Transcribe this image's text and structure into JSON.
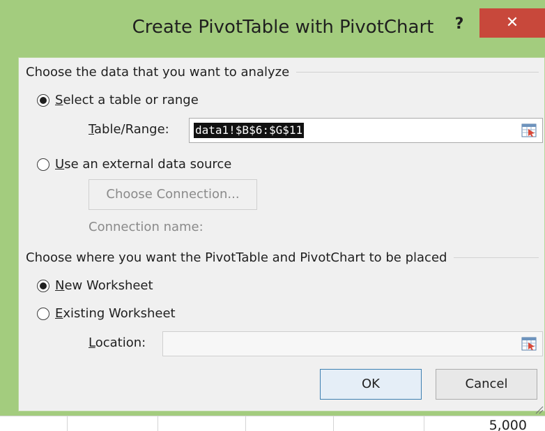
{
  "dialog": {
    "title": "Create PivotTable with PivotChart",
    "help_label": "?",
    "close_label": "✕",
    "title_bar_color": "#a3cc7e"
  },
  "data_source": {
    "heading": "Choose the data that you want to analyze",
    "option_range": {
      "prefix": "S",
      "rest": "elect a table or range",
      "checked": true
    },
    "table_range_label_prefix": "T",
    "table_range_label_rest": "able/Range:",
    "table_range_value": "data1!$B$6:$G$11",
    "option_external": {
      "prefix": "U",
      "rest": "se an external data source",
      "checked": false
    },
    "choose_connection_label": "Choose Connection...",
    "connection_name_label": "Connection name:"
  },
  "placement": {
    "heading": "Choose where you want the PivotTable and PivotChart to be placed",
    "option_new": {
      "prefix": "N",
      "rest": "ew Worksheet",
      "checked": true
    },
    "option_existing": {
      "prefix": "E",
      "rest": "xisting Worksheet",
      "checked": false
    },
    "location_label_prefix": "L",
    "location_label_rest": "ocation:",
    "location_value": ""
  },
  "buttons": {
    "ok_label": "OK",
    "cancel_label": "Cancel"
  },
  "background_sheet": {
    "visible_cell_value": "5,000"
  },
  "icons": {
    "range_picker": "range-selector-icon",
    "resize": "resize-grip-icon"
  },
  "colors": {
    "accent_selection": "#111111",
    "close_button": "#c8483b",
    "default_button_border": "#3c7fb1"
  }
}
